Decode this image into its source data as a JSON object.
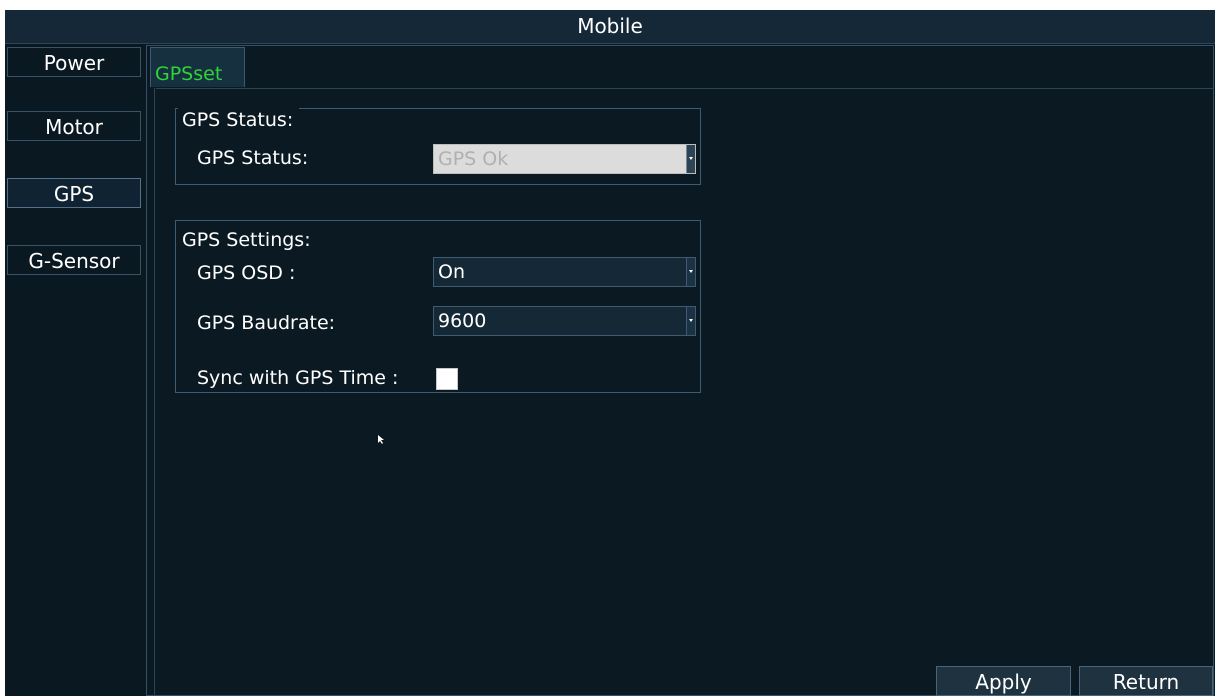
{
  "window": {
    "title": "Mobile"
  },
  "sidebar": {
    "items": [
      {
        "label": "Power"
      },
      {
        "label": "Motor"
      },
      {
        "label": "GPS"
      },
      {
        "label": "G-Sensor"
      }
    ],
    "active": "GPS"
  },
  "tabs": [
    {
      "label": "GPSset"
    }
  ],
  "gps_status_group": {
    "legend": "GPS Status:",
    "status_label": "GPS Status:",
    "status_value": "GPS Ok"
  },
  "gps_settings_group": {
    "legend": "GPS Settings:",
    "osd_label": "GPS OSD :",
    "osd_value": "On",
    "baudrate_label": "GPS Baudrate:",
    "baudrate_value": "9600",
    "sync_label": "Sync with GPS Time :",
    "sync_checked": false
  },
  "footer": {
    "apply_label": "Apply",
    "return_label": "Return"
  },
  "colors": {
    "accent_tab": "#2fd33a",
    "background": "#0a1822"
  },
  "icons": {
    "dropdown": "chevron-down-icon",
    "pointer": "mouse-pointer-icon"
  }
}
